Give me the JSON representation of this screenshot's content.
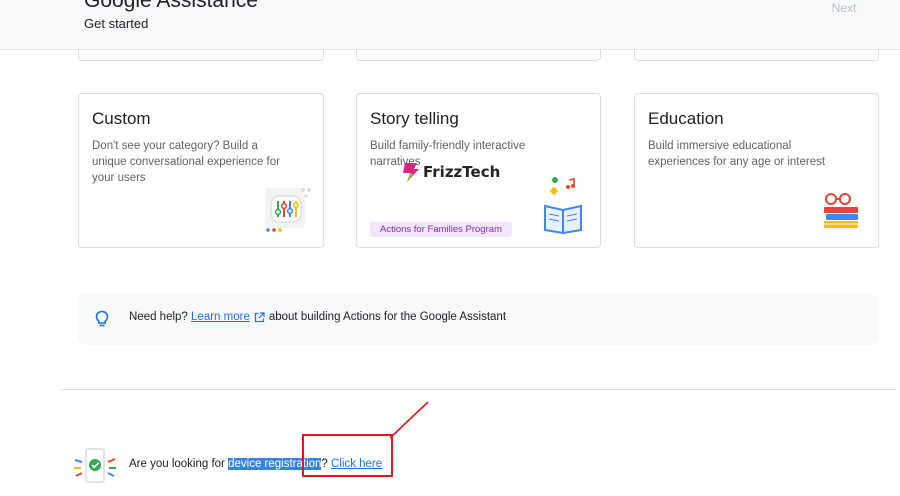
{
  "header": {
    "title": "Google Assistance",
    "subtitle": "Get started",
    "next_label": "Next"
  },
  "cards": [
    {
      "title": "Custom",
      "description": "Don't see your category? Build a unique conversational experience for your users",
      "icon": "sliders-chat-icon"
    },
    {
      "title": "Story telling",
      "description": "Build family-friendly interactive narratives",
      "badge": "Actions for Families Program",
      "icon": "open-book-music-icon"
    },
    {
      "title": "Education",
      "description": "Build immersive educational experiences for any age or interest",
      "icon": "books-glasses-icon"
    }
  ],
  "watermark": {
    "text": "FrizzTech"
  },
  "help": {
    "lead": "Need help?",
    "link": "Learn more",
    "trail": "about building Actions for the Google Assistant",
    "icon": "lightbulb-icon"
  },
  "registration": {
    "lead": "Are you looking for",
    "highlight": "device registration",
    "after": "?",
    "link": "Click here",
    "icon": "device-check-icon"
  },
  "colors": {
    "link": "#1a73e8",
    "highlight": "#3584e4",
    "annotation": "#e0191c",
    "badge_bg": "#f3e5fb",
    "badge_text": "#7b2fa8"
  }
}
